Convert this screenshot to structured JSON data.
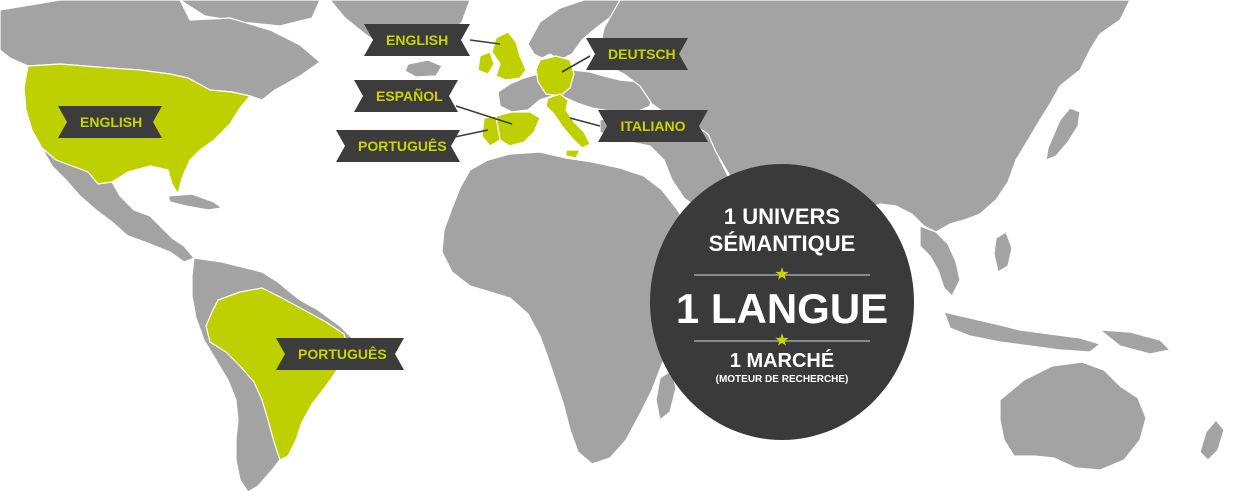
{
  "map": {
    "colors": {
      "land": "#a3a3a3",
      "highlight": "#bfd000",
      "label_bg": "#3c3c3c",
      "label_text": "#c6d600",
      "badge_bg": "#3a3a3a",
      "badge_text": "#ffffff",
      "background": "#ffffff"
    },
    "highlighted_regions": [
      "United States",
      "United Kingdom",
      "Germany",
      "Spain",
      "Portugal",
      "Italy",
      "Brazil"
    ],
    "labels": {
      "usa": "ENGLISH",
      "uk": "ENGLISH",
      "germany": "DEUTSCH",
      "spain": "ESPAÑOL",
      "portugal": "PORTUGUÊS",
      "italy": "ITALIANO",
      "brazil": "PORTUGUÊS"
    }
  },
  "badge": {
    "line1": "1 UNIVERS",
    "line2": "SÉMANTIQUE",
    "line3": "1 LANGUE",
    "line4": "1 MARCHÉ",
    "line5": "(MOTEUR DE RECHERCHE)",
    "star_icon": "star-icon"
  }
}
